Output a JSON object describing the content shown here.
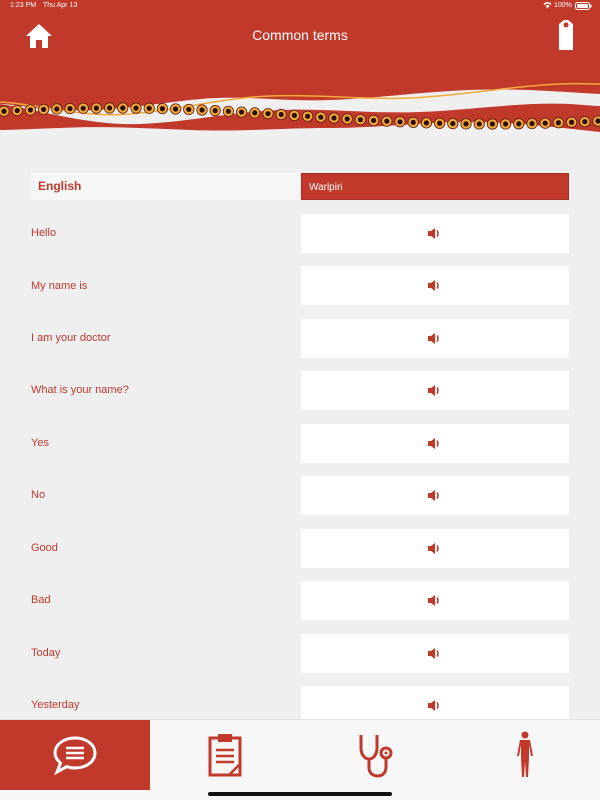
{
  "status_bar": {
    "time": "1:23 PM",
    "date": "Thu Apr 13",
    "battery": "100%"
  },
  "header": {
    "title": "Common terms",
    "home_icon": "home-icon",
    "profile_icon": "profile-card-icon"
  },
  "colors": {
    "primary": "#c0392b",
    "dot_ring": "#f2a93b",
    "background": "#efefef"
  },
  "table": {
    "col_english": "English",
    "col_language": "Warlpiri",
    "rows": [
      {
        "english": "Hello"
      },
      {
        "english": "My name is"
      },
      {
        "english": "I am your doctor"
      },
      {
        "english": "What is your name?"
      },
      {
        "english": "Yes"
      },
      {
        "english": "No"
      },
      {
        "english": "Good"
      },
      {
        "english": "Bad"
      },
      {
        "english": "Today"
      },
      {
        "english": "Yesterday"
      }
    ]
  },
  "tabs": [
    {
      "name": "common-terms",
      "icon": "speech-bubble-icon",
      "active": true
    },
    {
      "name": "notes",
      "icon": "clipboard-icon",
      "active": false
    },
    {
      "name": "health",
      "icon": "stethoscope-icon",
      "active": false
    },
    {
      "name": "body",
      "icon": "body-figure-icon",
      "active": false
    }
  ]
}
